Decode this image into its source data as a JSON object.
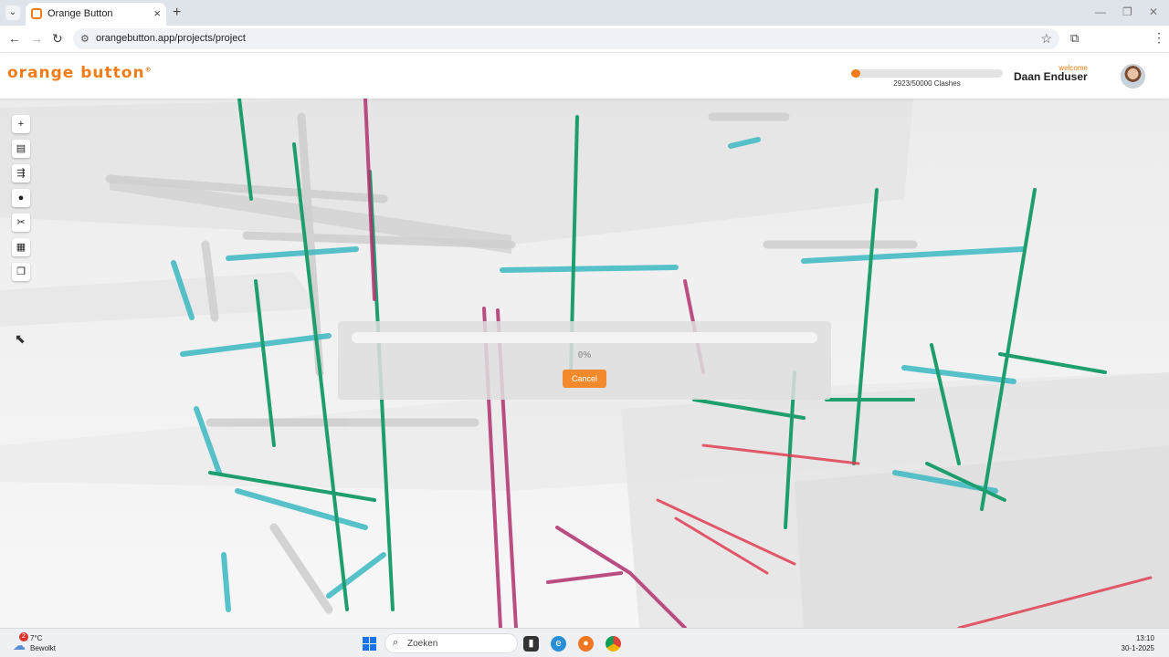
{
  "browser": {
    "tab_title": "Orange Button",
    "url": "orangebutton.app/projects/project"
  },
  "header": {
    "logo": "orange button",
    "logo_mark": "®",
    "clash_progress": 0.0585,
    "clash_text": "2923/50000 Clashes",
    "welcome": "welcome",
    "username": "Daan Enduser"
  },
  "tools": [
    {
      "name": "add-tool-button",
      "icon": "plus-icon",
      "glyph": "+"
    },
    {
      "name": "model-tree-button",
      "icon": "image-icon",
      "glyph": "▤"
    },
    {
      "name": "hierarchy-button",
      "icon": "hierarchy-icon",
      "glyph": "⇶"
    },
    {
      "name": "location-button",
      "icon": "map-pin-icon",
      "glyph": "●"
    },
    {
      "name": "section-cut-button",
      "icon": "scissors-icon",
      "glyph": "✂"
    },
    {
      "name": "layers-button",
      "icon": "cake-icon",
      "glyph": "▦"
    },
    {
      "name": "copy-button",
      "icon": "copy-icon",
      "glyph": "❐"
    }
  ],
  "loading": {
    "percent_text": "0%",
    "cancel_label": "Cancel"
  },
  "taskbar": {
    "weather_temp": "7°C",
    "weather_desc": "Bewolkt",
    "weather_badge": "2",
    "search_placeholder": "Zoeken",
    "time": "13:10",
    "date": "30-1-2025"
  },
  "colors": {
    "brand_orange": "#f07c1a",
    "pipe_green": "#1e9e6e",
    "pipe_teal": "#3cb8c2",
    "pipe_magenta": "#b0306e",
    "pipe_red": "#e0344a"
  }
}
